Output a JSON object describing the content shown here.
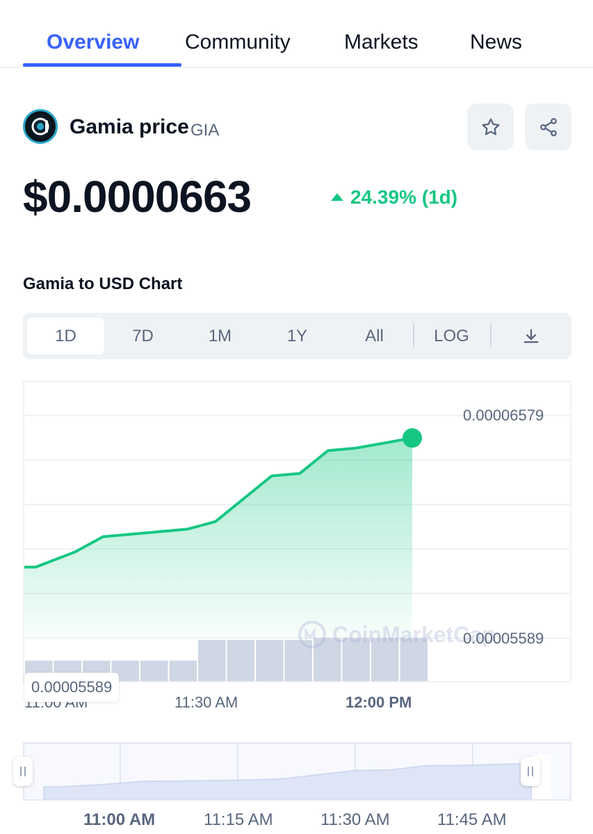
{
  "tabs": [
    {
      "label": "Overview",
      "active": true
    },
    {
      "label": "Community",
      "active": false
    },
    {
      "label": "Markets",
      "active": false
    },
    {
      "label": "News",
      "active": false
    }
  ],
  "coin": {
    "name": "Gamia price",
    "symbol": "GIA",
    "logo_icon": "gamia-logo-icon",
    "price": "$0.0000663",
    "change": "24.39% (1d)",
    "change_direction": "up",
    "change_color": "#16c784"
  },
  "actions": {
    "watchlist_icon": "star-icon",
    "share_icon": "share-icon"
  },
  "chart_title": "Gamia to USD Chart",
  "ranges": [
    {
      "label": "1D",
      "active": true
    },
    {
      "label": "7D",
      "active": false
    },
    {
      "label": "1M",
      "active": false
    },
    {
      "label": "1Y",
      "active": false
    },
    {
      "label": "All",
      "active": false
    },
    {
      "label": "LOG",
      "active": false
    }
  ],
  "download_icon": "download-icon",
  "watermark": "CoinMarketCap",
  "chart": {
    "y_high_label": "0.00006579",
    "y_low_label": "0.00005589",
    "current_price_tag": "0.00005589",
    "x_labels": [
      {
        "label": "11:00 AM",
        "bold": false
      },
      {
        "label": "11:30 AM",
        "bold": false
      },
      {
        "label": "12:00 PM",
        "bold": true
      }
    ]
  },
  "chart_data": {
    "type": "area",
    "title": "Gamia to USD Chart",
    "xlabel": "",
    "ylabel": "",
    "ylim": [
      5.53e-05,
      6.71e-05
    ],
    "line_color": "#16c784",
    "x": [
      "10:56",
      "10:58",
      "11:05",
      "11:10",
      "11:15",
      "11:20",
      "11:25",
      "11:30",
      "11:35",
      "11:40",
      "11:45",
      "11:50",
      "11:55",
      "12:00",
      "12:05"
    ],
    "values": [
      5.98e-05,
      5.98e-05,
      6.04e-05,
      6.1e-05,
      6.11e-05,
      6.12e-05,
      6.13e-05,
      6.16e-05,
      6.25e-05,
      6.34e-05,
      6.35e-05,
      6.44e-05,
      6.45e-05,
      6.47e-05,
      6.49e-05
    ],
    "volume_x": [
      "10:55",
      "11:00",
      "11:05",
      "11:10",
      "11:15",
      "11:20",
      "11:25",
      "11:30",
      "11:35",
      "11:40",
      "11:45",
      "11:50",
      "11:55",
      "12:00"
    ],
    "volume": [
      0.5,
      0.5,
      0.5,
      0.5,
      0.5,
      0.5,
      1.0,
      1.0,
      1.0,
      1.0,
      1.05,
      1.05,
      1.05,
      1.05
    ],
    "grid": true
  },
  "navigator": {
    "labels": [
      {
        "label": "11:00 AM",
        "bold": true
      },
      {
        "label": "11:15 AM",
        "bold": false
      },
      {
        "label": "11:30 AM",
        "bold": false
      },
      {
        "label": "11:45 AM",
        "bold": false
      }
    ]
  }
}
